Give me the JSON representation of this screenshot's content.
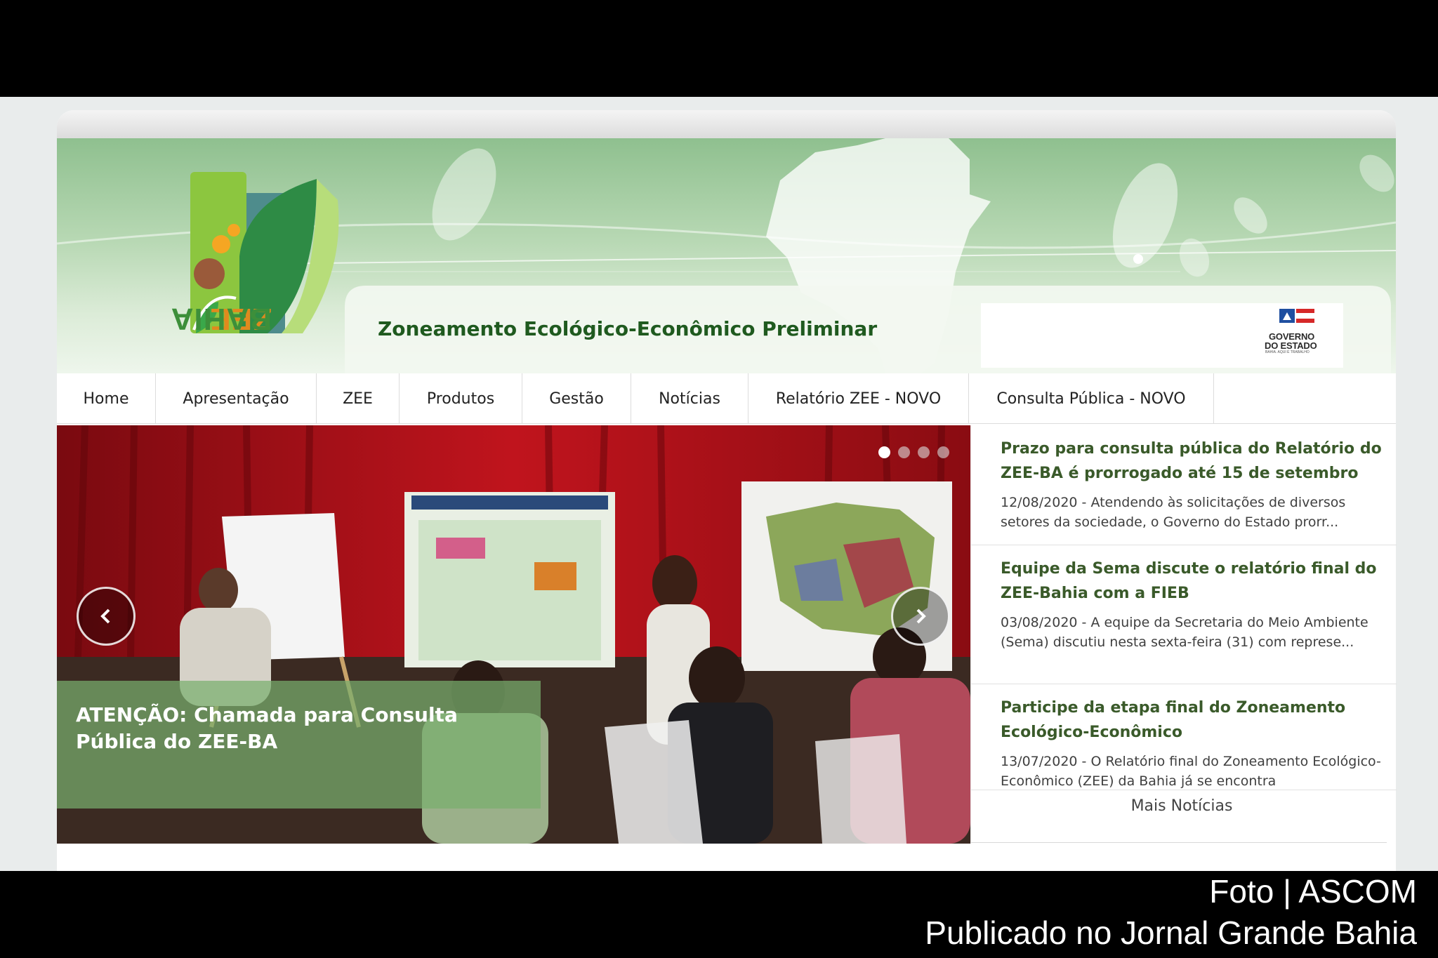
{
  "logo": {
    "word1": "ZEE",
    "word2": "BAHIA"
  },
  "header": {
    "title": "Zoneamento Ecológico-Econômico Preliminar"
  },
  "government_logo": {
    "line1": "GOVERNO",
    "line2": "DO ESTADO",
    "tagline": "BAHIA. AQUI É TRABALHO"
  },
  "nav": {
    "items": [
      {
        "label": "Home"
      },
      {
        "label": "Apresentação"
      },
      {
        "label": "ZEE"
      },
      {
        "label": "Produtos"
      },
      {
        "label": "Gestão"
      },
      {
        "label": "Notícias"
      },
      {
        "label": "Relatório ZEE - NOVO"
      },
      {
        "label": "Consulta Pública - NOVO"
      }
    ]
  },
  "slider": {
    "caption": "ATENÇÃO: Chamada para Consulta Pública do ZEE-BA",
    "slide_count": 4,
    "active_slide": 1
  },
  "news": {
    "items": [
      {
        "title": "Prazo para consulta pública do Relatório do ZEE-BA é prorrogado até 15 de setembro",
        "excerpt": "12/08/2020 - Atendendo às  solicitações de diversos setores da sociedade, o Governo do Estado prorr..."
      },
      {
        "title": "Equipe da Sema discute o relatório final do ZEE-Bahia com a FIEB",
        "excerpt": "03/08/2020 - A equipe da Secretaria do Meio Ambiente (Sema) discutiu nesta sexta-feira (31) com represe..."
      },
      {
        "title": "Participe da etapa final do Zoneamento Ecológico-Econômico",
        "excerpt": "13/07/2020 - O Relatório final do Zoneamento Ecológico-Econômico (ZEE) da Bahia já se encontra"
      }
    ],
    "more_label": "Mais Notícias"
  },
  "photo_credit": {
    "line1": "Foto | ASCOM",
    "line2": "Publicado no Jornal Grande Bahia"
  },
  "colors": {
    "header_green": "#8fc08f",
    "title_green": "#1f5a1f",
    "news_title": "#3a5a2a",
    "caption_overlay": "#78af6e",
    "curtain_red": "#b0121a"
  }
}
